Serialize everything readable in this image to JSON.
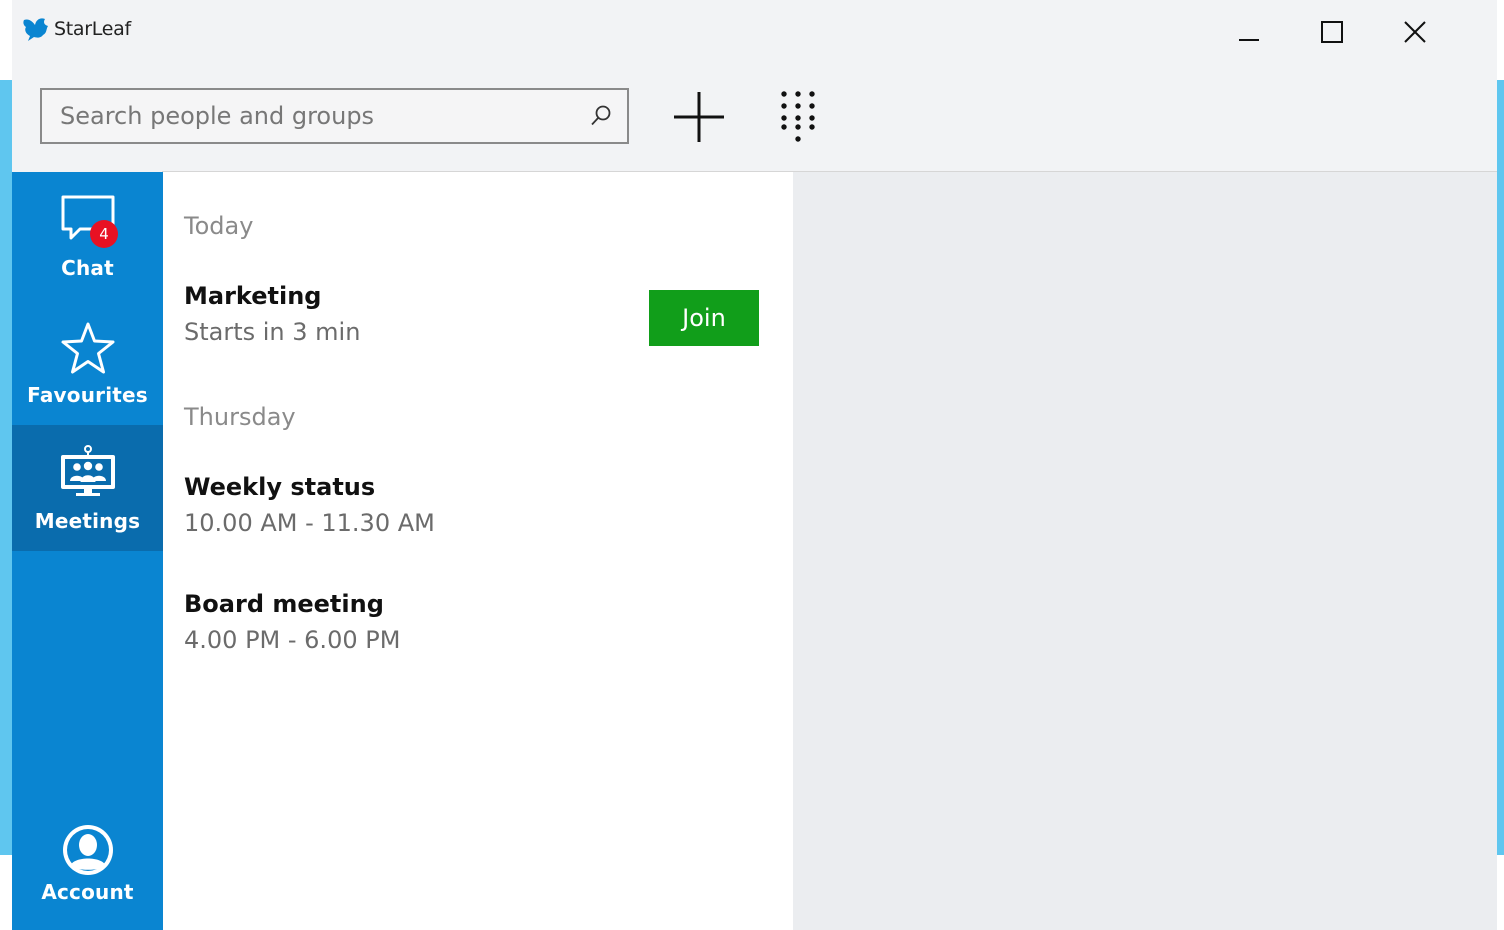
{
  "window": {
    "title": "StarLeaf"
  },
  "toolbar": {
    "search_placeholder": "Search people and groups"
  },
  "sidebar": {
    "items": [
      {
        "label": "Chat",
        "icon": "chat-icon",
        "badge": "4"
      },
      {
        "label": "Favourites",
        "icon": "star-icon"
      },
      {
        "label": "Meetings",
        "icon": "meetings-icon",
        "active": true
      },
      {
        "label": "Account",
        "icon": "account-icon"
      }
    ]
  },
  "meetings": {
    "sections": [
      {
        "header": "Today",
        "items": [
          {
            "title": "Marketing",
            "time": "Starts in 3 min",
            "action": "Join"
          }
        ]
      },
      {
        "header": "Thursday",
        "items": [
          {
            "title": "Weekly status",
            "time": "10.00 AM - 11.30 AM"
          },
          {
            "title": "Board meeting",
            "time": "4.00 PM - 6.00 PM"
          }
        ]
      }
    ]
  },
  "colors": {
    "sidebar": "#0a85d1",
    "sidebar_active": "#0a6cad",
    "join_button": "#119e1a",
    "badge": "#e81123",
    "backdrop": "#5fc6ef"
  }
}
